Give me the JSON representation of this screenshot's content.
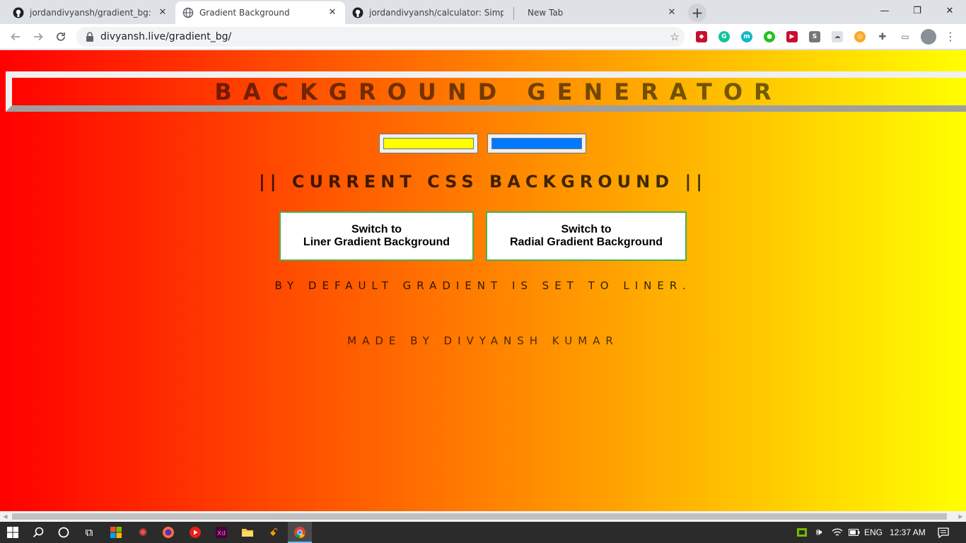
{
  "browser": {
    "tabs": [
      {
        "title": "jordandivyansh/gradient_bg: Gra",
        "icon": "github-icon",
        "active": false
      },
      {
        "title": "Gradient Background",
        "icon": "globe-icon",
        "active": true
      },
      {
        "title": "jordandivyansh/calculator: Simpe",
        "icon": "github-icon",
        "active": false
      },
      {
        "title": "New Tab",
        "icon": "",
        "active": false
      }
    ],
    "new_tab_label": "+",
    "url": "divyansh.live/gradient_bg/",
    "window_controls": {
      "minimize": "—",
      "maximize": "❐",
      "close": "✕"
    }
  },
  "page": {
    "banner_title": "BACKGROUND GENERATOR",
    "color1": "#ffff00",
    "color2": "#0078ff",
    "css_heading": "|| CURRENT CSS BACKGROUND ||",
    "linear_button": {
      "line1": "Switch to",
      "line2": "Liner Gradient Background"
    },
    "radial_button": {
      "line1": "Switch to",
      "line2": "Radial Gradient Background"
    },
    "default_note": "BY DEFAULT GRADIENT IS SET TO LINER.",
    "made_by": "MADE BY DIVYANSH KUMAR",
    "gradient": {
      "from": "#ff0000",
      "to": "#ffff00"
    }
  },
  "taskbar": {
    "language": "ENG",
    "time": "12:37 AM"
  }
}
